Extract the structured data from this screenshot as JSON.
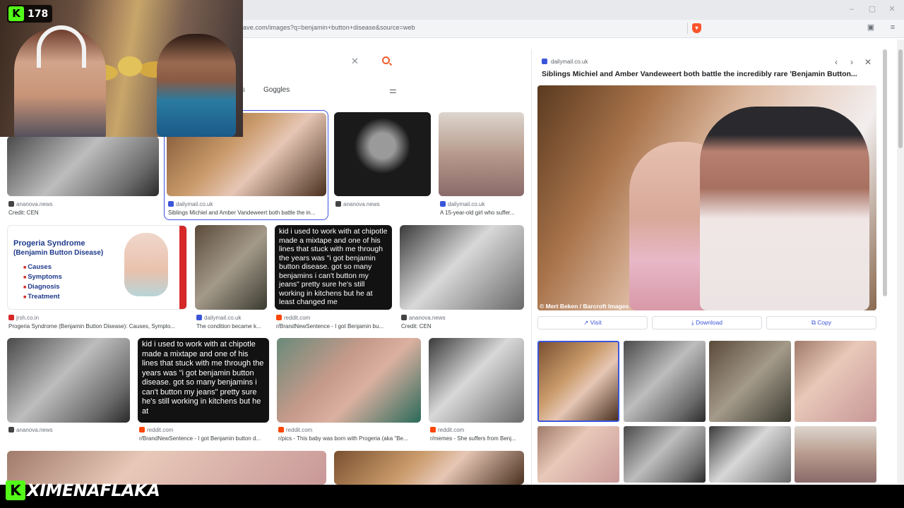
{
  "browser": {
    "url": "ave.com/images?q=benjamin+button+disease&source=web"
  },
  "search": {
    "tab_partial": "s",
    "tab_goggles": "Goggles"
  },
  "results": [
    {
      "source": "ananova.news",
      "caption": "Credit: CEN",
      "fav_color": "#444444"
    },
    {
      "source": "dailymail.co.uk",
      "caption": "Siblings Michiel and Amber Vandeweert both battle the in...",
      "fav_color": "#3b55d9"
    },
    {
      "source": "ananova.news",
      "caption": "",
      "fav_color": "#444444"
    },
    {
      "source": "dailymail.co.uk",
      "caption": "A 15-year-old girl who suffer...",
      "fav_color": "#3b55d9"
    },
    {
      "source": "jrsh.co.in",
      "caption": "Progeria Syndrome (Benjamin Button Disease): Causes, Sympto...",
      "fav_color": "#d62828"
    },
    {
      "source": "dailymail.co.uk",
      "caption": "The condition became k...",
      "fav_color": "#3b55d9"
    },
    {
      "source": "reddit.com",
      "caption": "r/BrandNewSentence - I got Benjamin bu...",
      "fav_color": "#ff4500"
    },
    {
      "source": "ananova.news",
      "caption": "Credit: CEN",
      "fav_color": "#444444"
    },
    {
      "source": "ananova.news",
      "caption": "",
      "fav_color": "#444444"
    },
    {
      "source": "reddit.com",
      "caption": "r/BrandNewSentence - I got Benjamin button d...",
      "fav_color": "#ff4500"
    },
    {
      "source": "reddit.com",
      "caption": "r/pics - This baby was born with Progeria (aka \"Be...",
      "fav_color": "#ff4500"
    },
    {
      "source": "reddit.com",
      "caption": "r/memes - She suffers from Benj...",
      "fav_color": "#ff4500"
    }
  ],
  "meme_text": "kid i used to work with at chipotle made a mixtape and one of his lines that stuck with me through the years was \"i got benjamin button disease. got so many benjamins i can't button my jeans\" pretty sure he's still working in kitchens but he at least changed me",
  "meme_text_cropped": "kid i used to work with at chipotle made a mixtape and one of his lines that stuck with me through the years was \"i got benjamin button disease. got so many benjamins i can't button my jeans\" pretty sure he's still working in kitchens but he at",
  "infographic": {
    "title": "Progeria Syndrome",
    "subtitle": "(Benjamin Button Disease)",
    "items": [
      "Causes",
      "Symptoms",
      "Diagnosis",
      "Treatment"
    ]
  },
  "detail": {
    "source": "dailymail.co.uk",
    "title": "Siblings Michiel and Amber Vandeweert both battle the incredibly rare 'Benjamin Button...",
    "credit": "© Mert Beken / Barcroft Images",
    "visit_label": "Visit",
    "download_label": "Download",
    "copy_label": "Copy"
  },
  "overlay": {
    "viewer_count": "178",
    "channel_name": "XIMENAFLAKA",
    "logo_letter": "K"
  },
  "colors": {
    "accent": "#3b55d9",
    "brave": "#fb542b",
    "kick_green": "#53fc18"
  }
}
